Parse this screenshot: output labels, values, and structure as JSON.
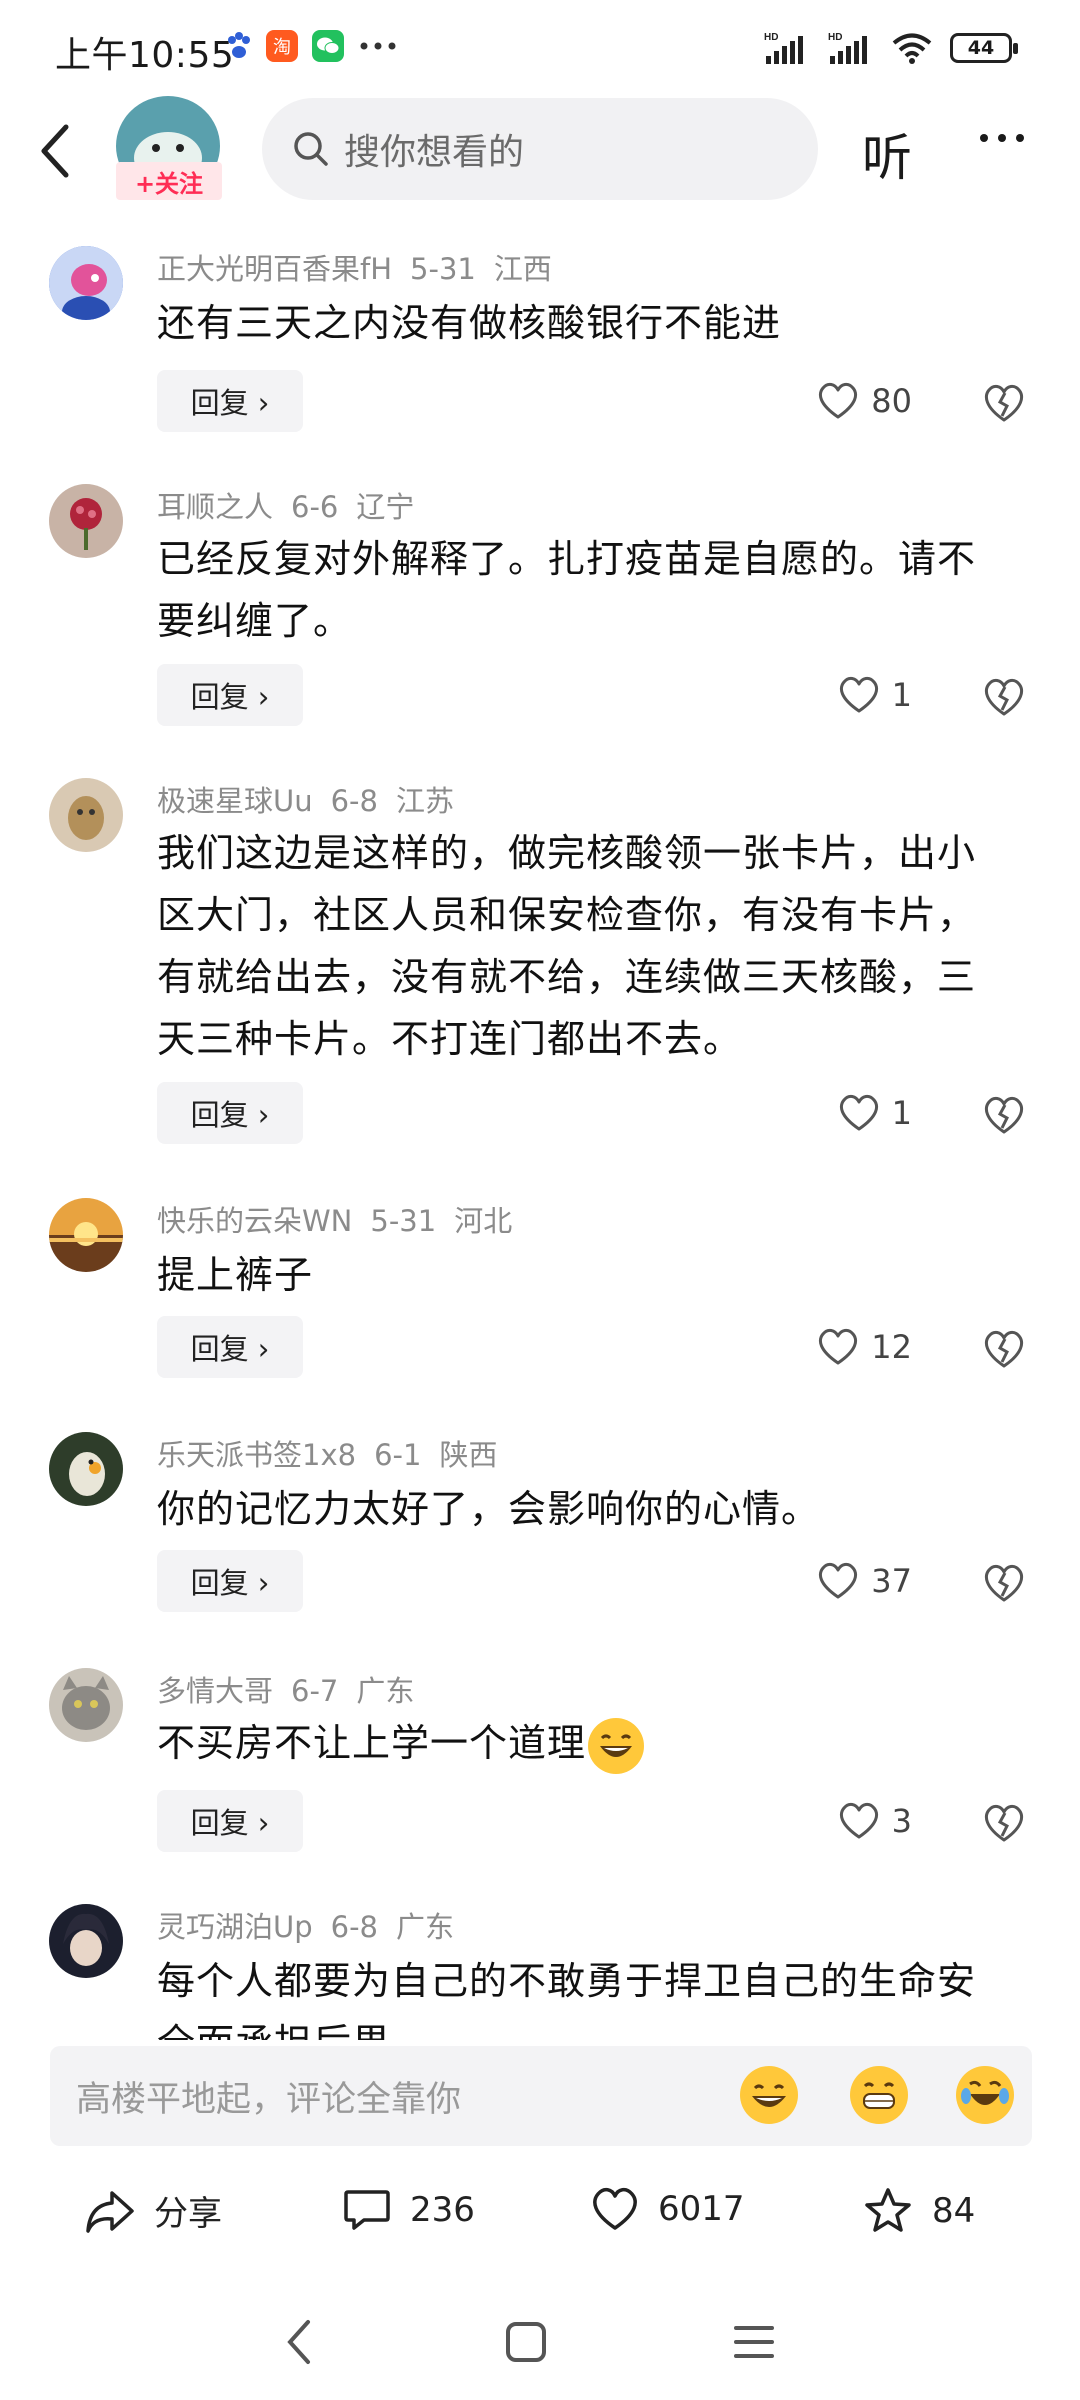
{
  "status_bar": {
    "time": "上午10:55",
    "battery": "44"
  },
  "header": {
    "follow_label": "+关注",
    "search_placeholder": "搜你想看的",
    "listen_label": "听"
  },
  "comments": [
    {
      "user": "正大光明百香果fH",
      "date": "5-31",
      "region": "江西",
      "text": "还有三天之内没有做核酸银行不能进",
      "likes": "80",
      "reply": "回复 ›"
    },
    {
      "user": "耳顺之人",
      "date": "6-6",
      "region": "辽宁",
      "text": "已经反复对外解释了。扎打疫苗是自愿的。请不要纠缠了。",
      "likes": "1",
      "reply": "回复 ›"
    },
    {
      "user": "极速星球Uu",
      "date": "6-8",
      "region": "江苏",
      "text": "我们这边是这样的，做完核酸领一张卡片，出小区大门，社区人员和保安检查你，有没有卡片，有就给出去，没有就不给，连续做三天核酸，三天三种卡片。不打连门都出不去。",
      "likes": "1",
      "reply": "回复 ›"
    },
    {
      "user": "快乐的云朵WN",
      "date": "5-31",
      "region": "河北",
      "text": "提上裤子",
      "likes": "12",
      "reply": "回复 ›"
    },
    {
      "user": "乐天派书签1x8",
      "date": "6-1",
      "region": "陕西",
      "text": "你的记忆力太好了，会影响你的心情。",
      "likes": "37",
      "reply": "回复 ›"
    },
    {
      "user": "多情大哥",
      "date": "6-7",
      "region": "广东",
      "text": "不买房不让上学一个道理",
      "likes": "3",
      "reply": "回复 ›"
    },
    {
      "user": "灵巧湖泊Up",
      "date": "6-8",
      "region": "广东",
      "text": "每个人都要为自己的不敢勇于捍卫自己的生命安全而承担后果",
      "likes": "",
      "reply": ""
    }
  ],
  "input": {
    "placeholder": "高楼平地起，评论全靠你"
  },
  "actions": {
    "share": "分享",
    "comments": "236",
    "likes": "6017",
    "favorites": "84"
  }
}
